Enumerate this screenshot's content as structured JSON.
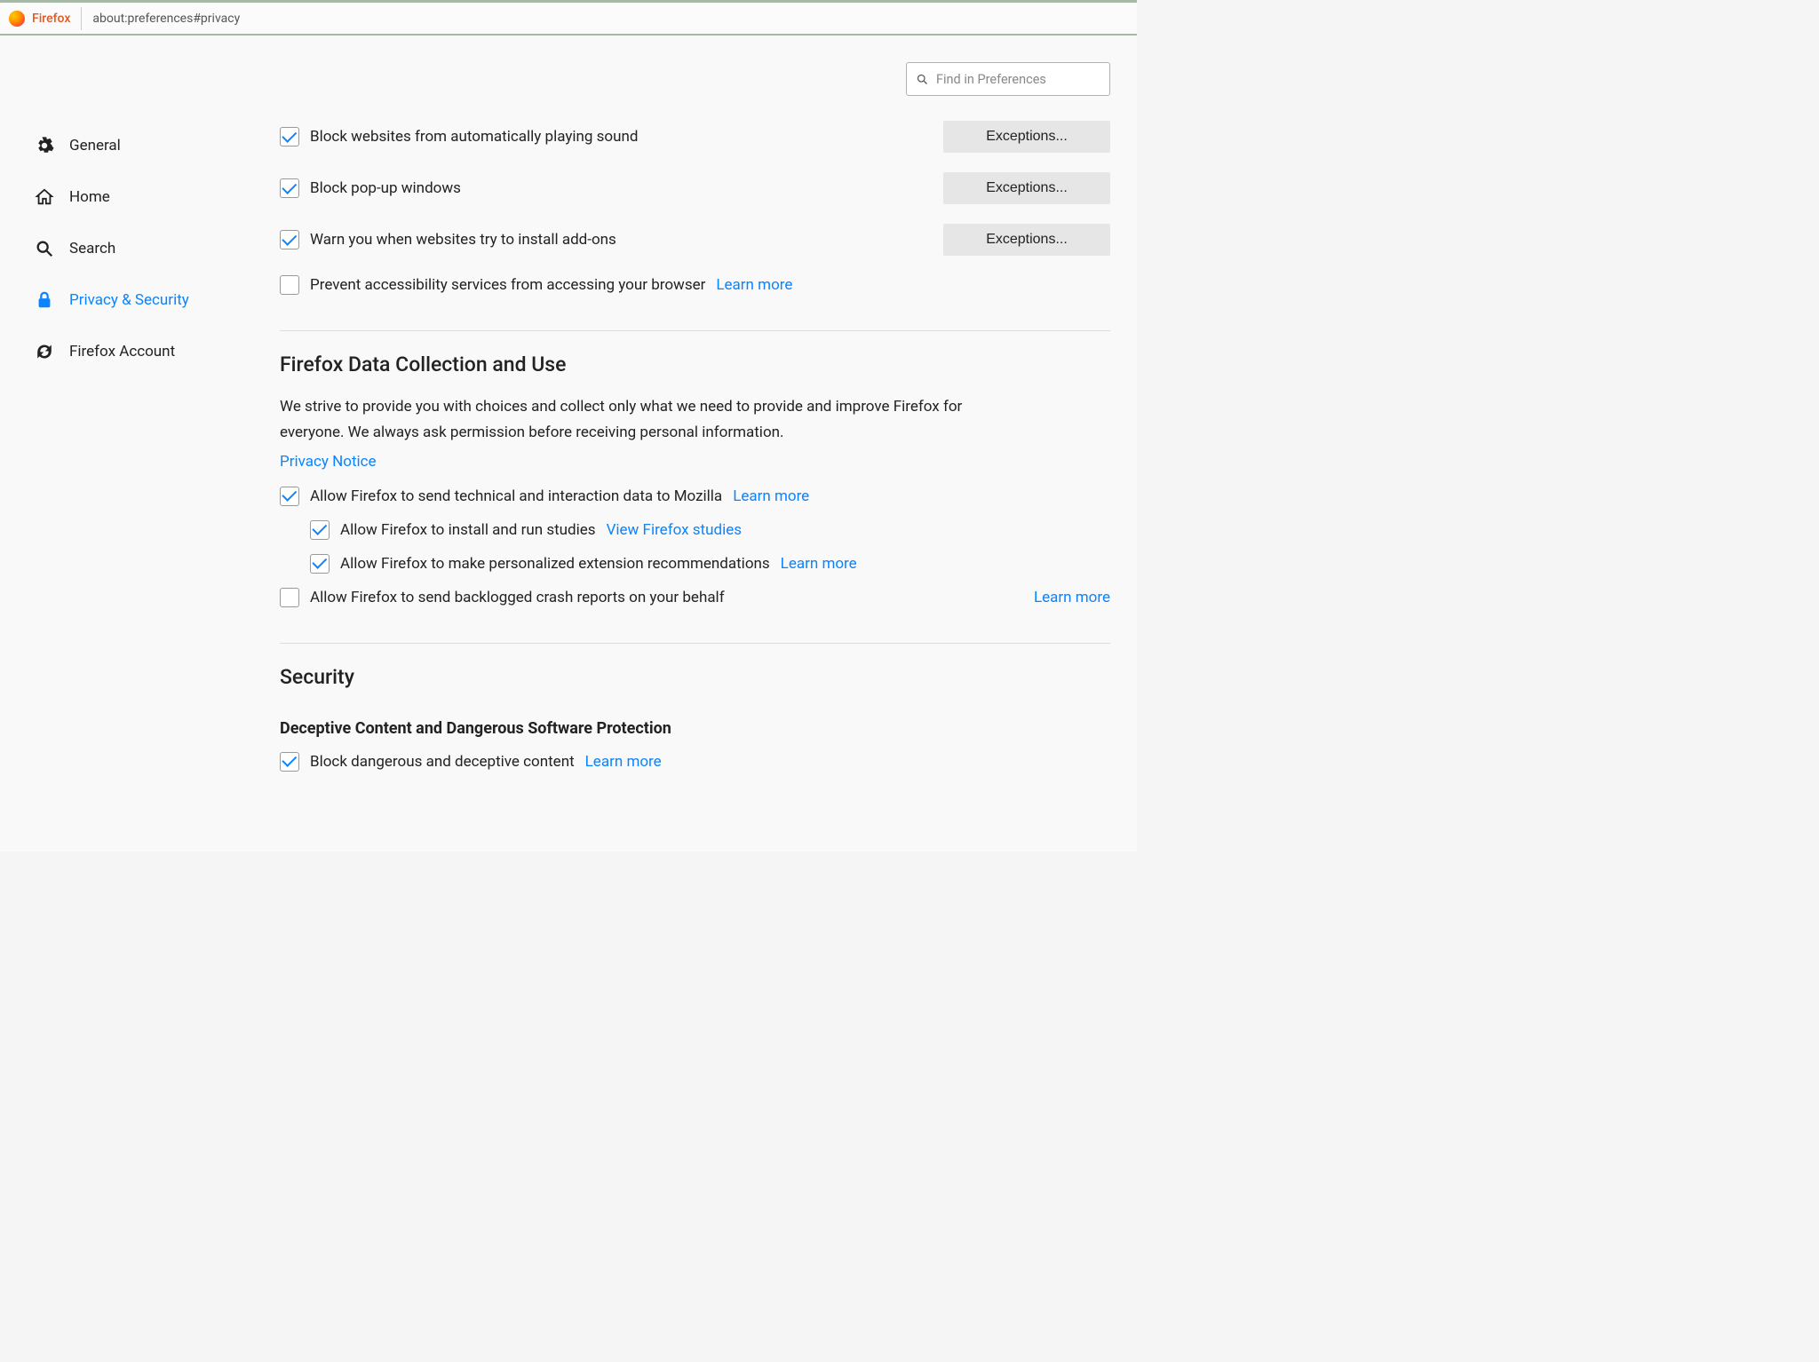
{
  "urlbar": {
    "app": "Firefox",
    "path": "about:preferences#privacy"
  },
  "sidebar": {
    "items": [
      {
        "label": "General"
      },
      {
        "label": "Home"
      },
      {
        "label": "Search"
      },
      {
        "label": "Privacy & Security"
      },
      {
        "label": "Firefox Account"
      }
    ]
  },
  "search": {
    "placeholder": "Find in Preferences"
  },
  "perm": {
    "autoplay": "Block websites from automatically playing sound",
    "popup": "Block pop-up windows",
    "addons": "Warn you when websites try to install add-ons",
    "a11y": "Prevent accessibility services from accessing your browser",
    "learnmore": "Learn more",
    "exceptions": "Exceptions..."
  },
  "data": {
    "title": "Firefox Data Collection and Use",
    "desc": "We strive to provide you with choices and collect only what we need to provide and improve Firefox for everyone. We always ask permission before receiving personal information.",
    "privacy_notice": "Privacy Notice",
    "telemetry": "Allow Firefox to send technical and interaction data to Mozilla",
    "studies": "Allow Firefox to install and run studies",
    "studies_link": "View Firefox studies",
    "recommendations": "Allow Firefox to make personalized extension recommendations",
    "crashreports": "Allow Firefox to send backlogged crash reports on your behalf",
    "learnmore": "Learn more"
  },
  "security": {
    "title": "Security",
    "subhead": "Deceptive Content and Dangerous Software Protection",
    "block_dangerous": "Block dangerous and deceptive content",
    "learnmore": "Learn more"
  }
}
